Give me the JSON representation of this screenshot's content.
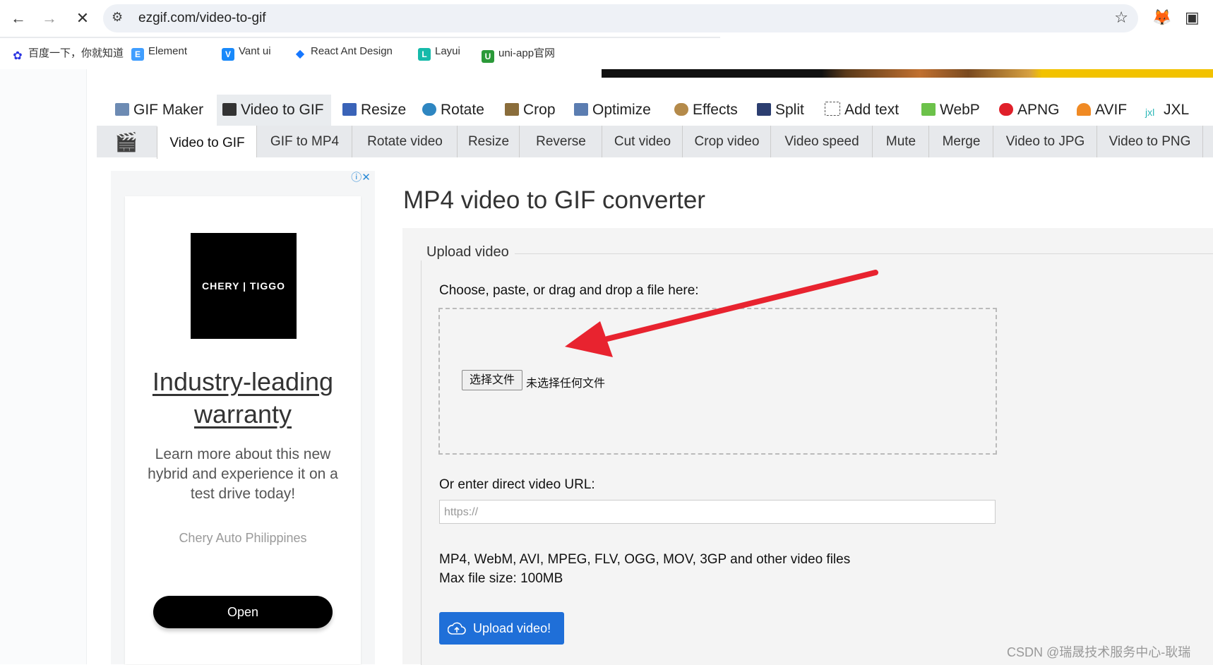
{
  "browser": {
    "url": "ezgif.com/video-to-gif",
    "bookmarks": [
      "百度一下，你就知道",
      "Element",
      "Vant ui",
      "React Ant Design",
      "Layui",
      "uni-app官网"
    ]
  },
  "main_nav": [
    {
      "label": "GIF Maker",
      "icon": "gif-maker-icon"
    },
    {
      "label": "Video to GIF",
      "icon": "video-icon"
    },
    {
      "label": "Resize",
      "icon": "resize-icon"
    },
    {
      "label": "Rotate",
      "icon": "rotate-icon"
    },
    {
      "label": "Crop",
      "icon": "crop-icon"
    },
    {
      "label": "Optimize",
      "icon": "optimize-icon"
    },
    {
      "label": "Effects",
      "icon": "effects-icon"
    },
    {
      "label": "Split",
      "icon": "split-icon"
    },
    {
      "label": "Add text",
      "icon": "add-text-icon"
    },
    {
      "label": "WebP",
      "icon": "webp-icon"
    },
    {
      "label": "APNG",
      "icon": "apng-icon"
    },
    {
      "label": "AVIF",
      "icon": "avif-icon"
    },
    {
      "label": "JXL",
      "icon": "jxl-icon"
    }
  ],
  "sub_nav": [
    "Video to GIF",
    "GIF to MP4",
    "Rotate video",
    "Resize",
    "Reverse",
    "Cut video",
    "Crop video",
    "Video speed",
    "Mute",
    "Merge",
    "Video to JPG",
    "Video to PNG"
  ],
  "ad": {
    "logo_text": "CHERY | TIGGO",
    "headline": "Industry-leading warranty",
    "body": "Learn more about this new hybrid and experience it on a test drive today!",
    "sponsor": "Chery Auto Philippines",
    "button": "Open"
  },
  "page": {
    "title": "MP4 video to GIF converter",
    "legend": "Upload video",
    "choose_label": "Choose, paste, or drag and drop a file here:",
    "choose_file_button": "选择文件",
    "no_file_text": "未选择任何文件",
    "url_label": "Or enter direct video URL:",
    "url_placeholder": "https://",
    "formats_text": "MP4, WebM, AVI, MPEG, FLV, OGG, MOV, 3GP and other video files",
    "max_size_text": "Max file size: 100MB",
    "upload_button": "Upload video!"
  },
  "watermark": "CSDN @瑞晟技术服务中心-耿瑞",
  "colors": {
    "primary_button": "#1f6fd8",
    "annotation_arrow": "#e8232f"
  }
}
